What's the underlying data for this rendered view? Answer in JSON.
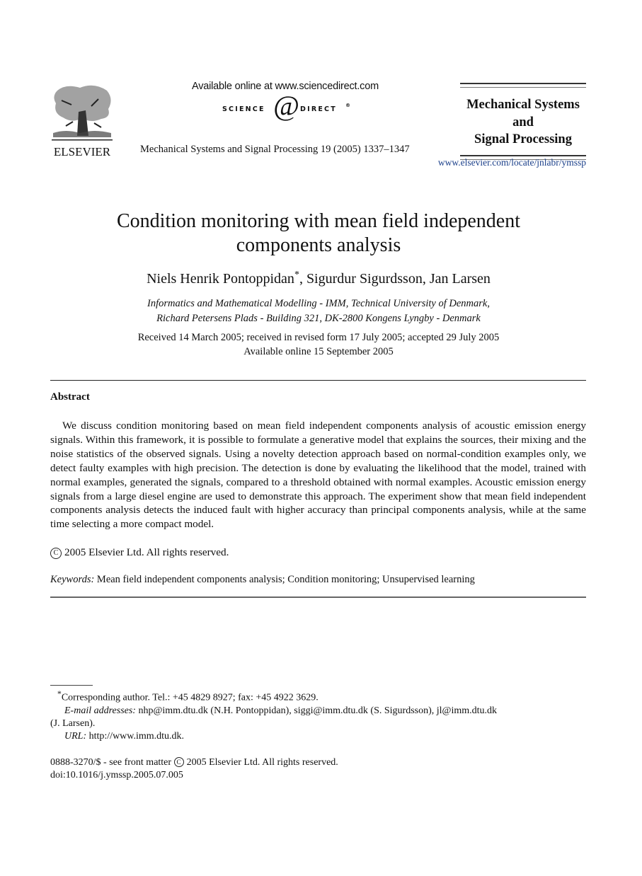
{
  "header": {
    "publisher_logo_text": "ELSEVIER",
    "publisher_logo_icon": "elsevier-tree-icon",
    "sciencedirect_available": "Available online at www.sciencedirect.com",
    "sciencedirect_logo": {
      "left_word": "SCIENCE",
      "symbol": "@",
      "right_word": "DIRECT",
      "mark": "®"
    },
    "journal_citation": "Mechanical Systems and Signal Processing 19 (2005) 1337–1347",
    "journal_name_lines": [
      "Mechanical Systems",
      "and",
      "Signal Processing"
    ],
    "journal_url": "www.elsevier.com/locate/jnlabr/ymssp",
    "url_color": "#1a3f8a"
  },
  "article": {
    "title_lines": [
      "Condition monitoring with mean field independent",
      "components analysis"
    ],
    "authors": {
      "first": "Niels Henrik Pontoppidan",
      "first_mark": "*",
      "rest": ", Sigurdur Sigurdsson, Jan Larsen"
    },
    "affiliation_lines": [
      "Informatics and Mathematical Modelling - IMM, Technical University of Denmark,",
      "Richard Petersens Plads - Building 321, DK-2800 Kongens Lyngby - Denmark"
    ],
    "dates_lines": [
      "Received 14 March 2005; received in revised form 17 July 2005; accepted 29 July 2005",
      "Available online 15 September 2005"
    ]
  },
  "abstract": {
    "heading": "Abstract",
    "body": "We discuss condition monitoring based on mean field independent components analysis of acoustic emission energy signals. Within this framework, it is possible to formulate a generative model that explains the sources, their mixing and the noise statistics of the observed signals. Using a novelty detection approach based on normal-condition examples only, we detect faulty examples with high precision. The detection is done by evaluating the likelihood that the model, trained with normal examples, generated the signals, compared to a threshold obtained with normal examples. Acoustic emission energy signals from a large diesel engine are used to demonstrate this approach. The experiment show that mean field independent components analysis detects the induced fault with higher accuracy than principal components analysis, while at the same time selecting a more compact model.",
    "copyright_symbol": "C",
    "copyright": "2005 Elsevier Ltd. All rights reserved."
  },
  "keywords": {
    "label": "Keywords:",
    "text": "Mean field independent components analysis; Condition monitoring; Unsupervised learning"
  },
  "footnotes": {
    "corresponding_mark": "*",
    "corresponding": "Corresponding author. Tel.: +45 4829 8927; fax: +45 4922 3629.",
    "email_label": "E-mail addresses:",
    "email_text": "nhp@imm.dtu.dk (N.H. Pontoppidan), siggi@imm.dtu.dk (S. Sigurdsson), jl@imm.dtu.dk",
    "email_continued": "(J. Larsen).",
    "url_label": "URL:",
    "url_text": "http://www.imm.dtu.dk."
  },
  "front_matter": {
    "issn_prefix": "0888-3270/$ - see front matter",
    "copyright_symbol": "C",
    "copyright": "2005 Elsevier Ltd. All rights reserved.",
    "doi": "doi:10.1016/j.ymssp.2005.07.005"
  }
}
